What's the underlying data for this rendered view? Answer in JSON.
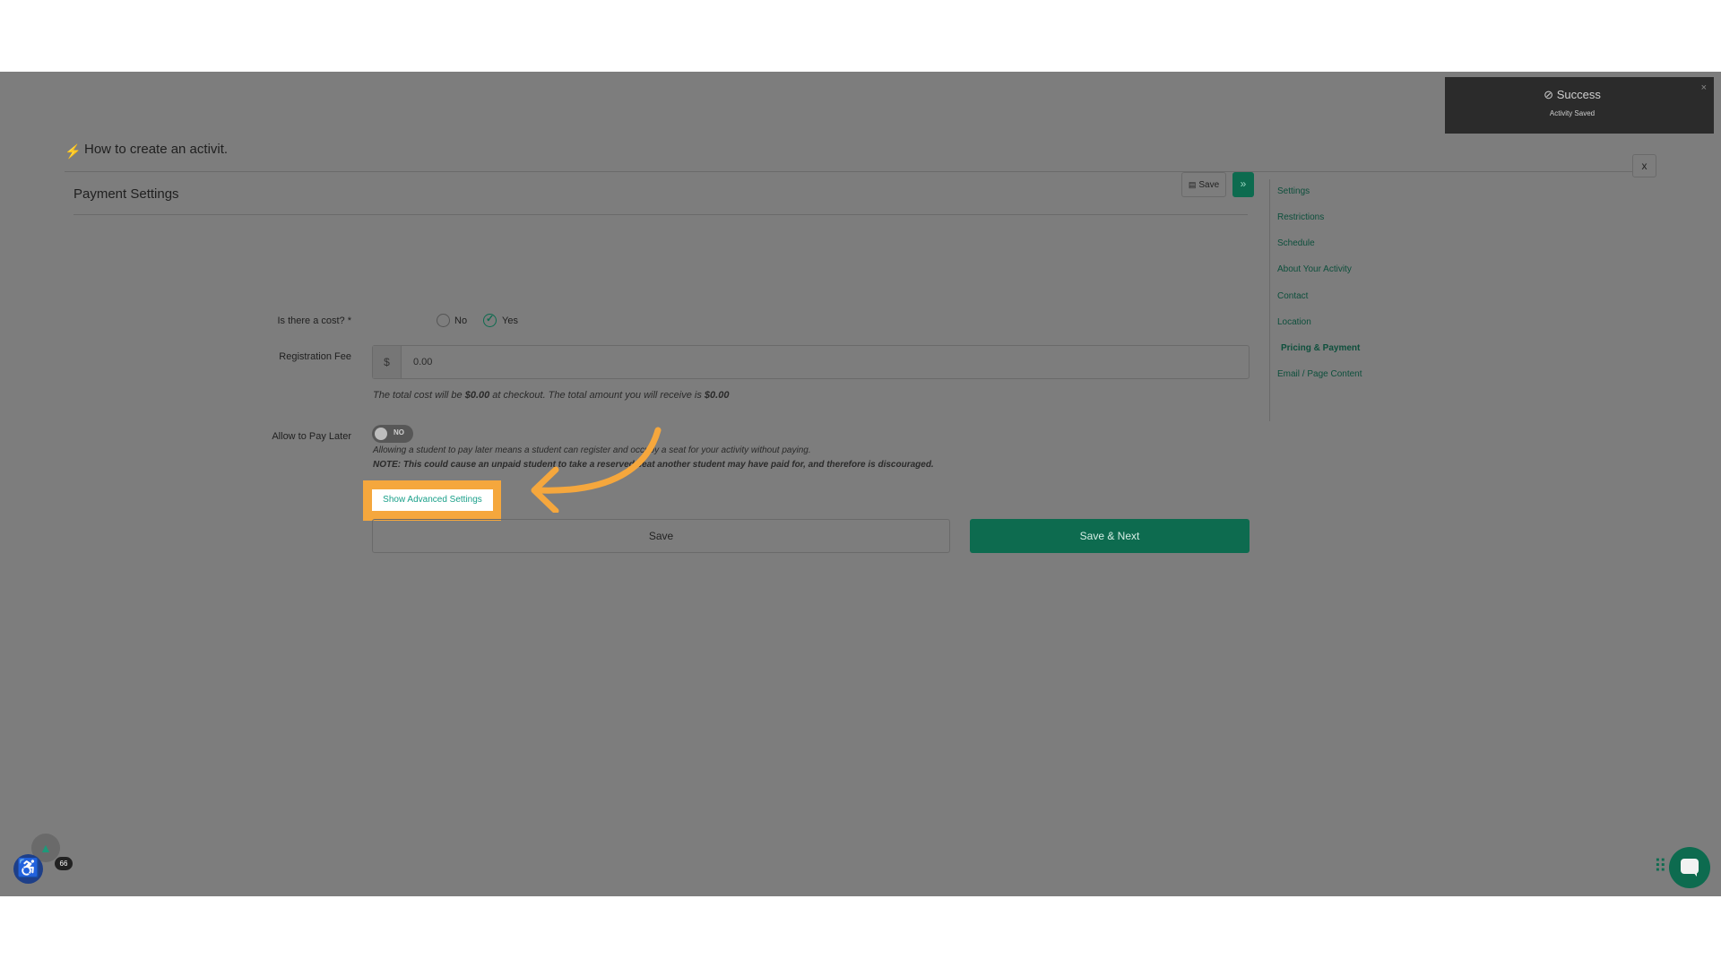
{
  "header": {
    "title": "How to create an activit."
  },
  "close_label": "x",
  "card": {
    "title": "Payment Settings",
    "save_small_label": "Save",
    "next_small_label": "»"
  },
  "cost": {
    "label": "Is there a cost? *",
    "options": [
      "No",
      "Yes"
    ],
    "selected": "Yes"
  },
  "fee": {
    "label": "Registration Fee",
    "prefix": "$",
    "value": "0.00",
    "hint_part1": "The total cost will be ",
    "hint_amount1": "$0.00",
    "hint_part2": " at checkout. The total amount you will receive is ",
    "hint_amount2": "$0.00"
  },
  "pay_later": {
    "label": "Allow to Pay Later",
    "toggle_label": "NO",
    "note1": "Allowing a student to pay later means a student can register and occupy a seat for your activity without paying.",
    "note2": "NOTE: This could cause an unpaid student to take a reserved seat another student may have paid for, and therefore is discouraged."
  },
  "advanced_label": "Show Advanced Settings",
  "actions": {
    "save": "Save",
    "save_next": "Save & Next"
  },
  "side_nav": [
    {
      "label": "Settings"
    },
    {
      "label": "Restrictions"
    },
    {
      "label": "Schedule"
    },
    {
      "label": "About Your Activity"
    },
    {
      "label": "Contact"
    },
    {
      "label": "Location"
    },
    {
      "label": "Pricing & Payment",
      "active": true
    },
    {
      "label": "Email / Page Content"
    }
  ],
  "toast": {
    "title": "Success",
    "message": "Activity Saved",
    "close": "×"
  },
  "widgets": {
    "badge_count": "66"
  },
  "colors": {
    "accent": "#0d6b4f",
    "highlight": "#f5a73d",
    "link": "#1aa08a",
    "overlay": "#7d7d7d"
  }
}
